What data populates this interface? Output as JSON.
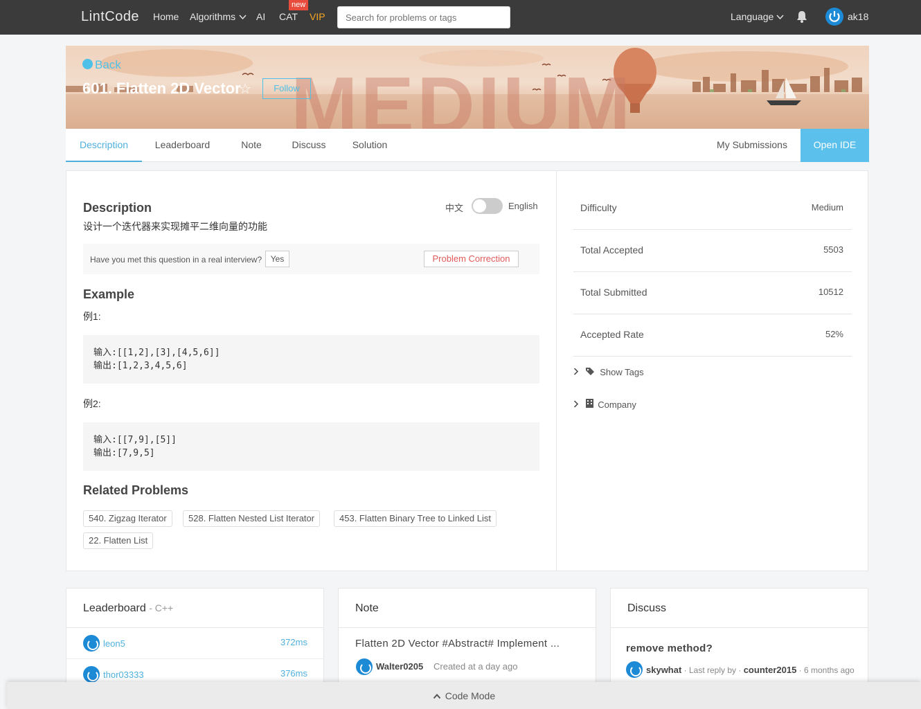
{
  "nav": {
    "logo": "LintCode",
    "home": "Home",
    "algorithms": "Algorithms",
    "ai": "AI",
    "cat": "CAT",
    "new_badge": "new",
    "vip": "VIP",
    "search_placeholder": "Search for problems or tags",
    "language": "Language",
    "username": "ak18"
  },
  "banner": {
    "back": "Back",
    "title": "601. Flatten 2D Vector",
    "follow": "Follow",
    "difficulty_word": "MEDIUM"
  },
  "tabs": [
    {
      "label": "Description",
      "active": true
    },
    {
      "label": "Leaderboard"
    },
    {
      "label": "Note"
    },
    {
      "label": "Discuss"
    },
    {
      "label": "Solution"
    }
  ],
  "tabs_right": {
    "my_submissions": "My Submissions",
    "open_ide": "Open IDE"
  },
  "description": {
    "heading": "Description",
    "lang_zh": "中文",
    "lang_en": "English",
    "text": "设计一个迭代器来实现摊平二维向量的功能",
    "interview_question": "Have you met this question in a real interview?",
    "yes": "Yes",
    "problem_correction": "Problem Correction",
    "example_heading": "Example",
    "examples": [
      {
        "label": "例1:",
        "input": "输入:[[1,2],[3],[4,5,6]]",
        "output": "输出:[1,2,3,4,5,6]"
      },
      {
        "label": "例2:",
        "input": "输入:[[7,9],[5]]",
        "output": "输出:[7,9,5]"
      }
    ],
    "related_heading": "Related Problems",
    "related": [
      "540. Zigzag Iterator",
      "528. Flatten Nested List Iterator",
      "453. Flatten Binary Tree to Linked List",
      "22. Flatten List"
    ]
  },
  "stats": {
    "difficulty_label": "Difficulty",
    "difficulty_value": "Medium",
    "accepted_label": "Total Accepted",
    "accepted_value": "5503",
    "submitted_label": "Total Submitted",
    "submitted_value": "10512",
    "rate_label": "Accepted Rate",
    "rate_value": "52%",
    "show_tags": "Show Tags",
    "company": "Company"
  },
  "leaderboard": {
    "title": "Leaderboard",
    "lang": "- C++",
    "rows": [
      {
        "name": "leon5",
        "time": "372ms"
      },
      {
        "name": "thor03333",
        "time": "376ms"
      }
    ]
  },
  "note": {
    "title": "Note",
    "entry_title": "Flatten 2D Vector #Abstract# Implement ...",
    "author": "Walter0205",
    "meta": "Created at a day ago"
  },
  "discuss": {
    "title": "Discuss",
    "entry_title": "remove method?",
    "author": "skywhat",
    "last_reply_text": "· Last reply by ·",
    "last_replier": "counter2015",
    "time": "· 6 months ago"
  },
  "code_mode": "Code Mode"
}
